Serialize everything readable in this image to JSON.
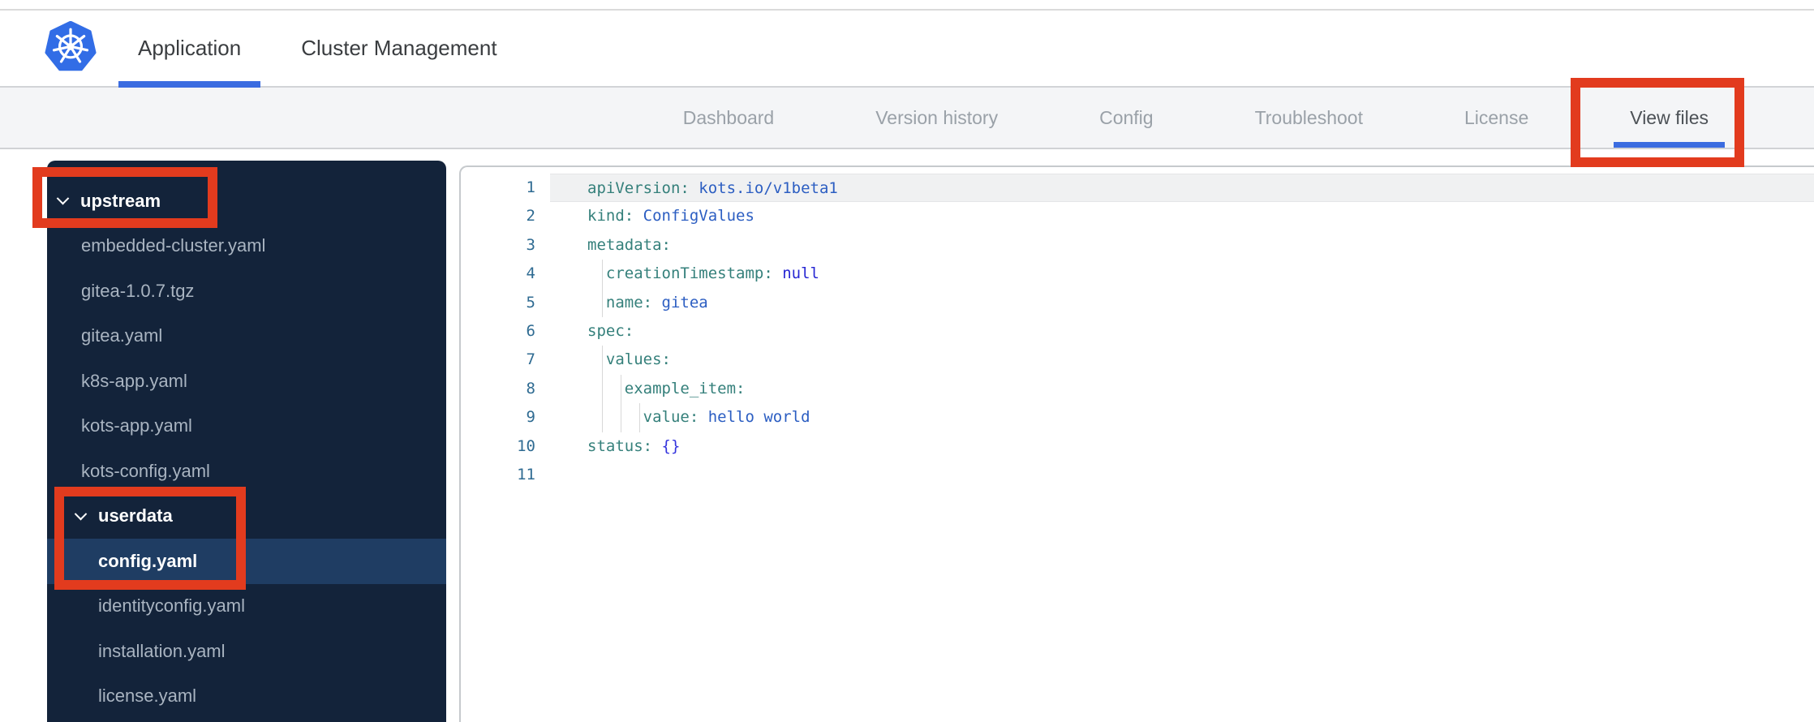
{
  "header": {
    "logo": "kubernetes-helm-wheel",
    "tabs": [
      {
        "label": "Application",
        "active": true
      },
      {
        "label": "Cluster Management",
        "active": false
      }
    ]
  },
  "subnav": {
    "items": [
      {
        "label": "Dashboard",
        "active": false
      },
      {
        "label": "Version history",
        "active": false
      },
      {
        "label": "Config",
        "active": false
      },
      {
        "label": "Troubleshoot",
        "active": false
      },
      {
        "label": "License",
        "active": false
      },
      {
        "label": "View files",
        "active": true,
        "annotated": true
      }
    ]
  },
  "file_tree": {
    "items": [
      {
        "type": "folder",
        "label": "upstream",
        "level": 0,
        "expanded": true,
        "annotated": true
      },
      {
        "type": "file",
        "label": "embedded-cluster.yaml",
        "level": 1
      },
      {
        "type": "file",
        "label": "gitea-1.0.7.tgz",
        "level": 1
      },
      {
        "type": "file",
        "label": "gitea.yaml",
        "level": 1
      },
      {
        "type": "file",
        "label": "k8s-app.yaml",
        "level": 1
      },
      {
        "type": "file",
        "label": "kots-app.yaml",
        "level": 1
      },
      {
        "type": "file",
        "label": "kots-config.yaml",
        "level": 1
      },
      {
        "type": "folder",
        "label": "userdata",
        "level": 1,
        "expanded": true,
        "annotated": true
      },
      {
        "type": "file",
        "label": "config.yaml",
        "level": 2,
        "selected": true,
        "annotated": true
      },
      {
        "type": "file",
        "label": "identityconfig.yaml",
        "level": 2
      },
      {
        "type": "file",
        "label": "installation.yaml",
        "level": 2
      },
      {
        "type": "file",
        "label": "license.yaml",
        "level": 2
      }
    ]
  },
  "editor": {
    "language": "yaml",
    "lines": [
      {
        "num": "1",
        "active": true,
        "guides": 0,
        "tokens": [
          [
            "key",
            "apiVersion:"
          ],
          [
            "val",
            " kots.io/v1beta1"
          ]
        ]
      },
      {
        "num": "2",
        "guides": 0,
        "tokens": [
          [
            "key",
            "kind:"
          ],
          [
            "val",
            " ConfigValues"
          ]
        ]
      },
      {
        "num": "3",
        "guides": 0,
        "tokens": [
          [
            "key",
            "metadata:"
          ]
        ]
      },
      {
        "num": "4",
        "guides": 1,
        "tokens": [
          [
            "key",
            "  creationTimestamp:"
          ],
          [
            "kw",
            " null"
          ]
        ]
      },
      {
        "num": "5",
        "guides": 1,
        "tokens": [
          [
            "key",
            "  name:"
          ],
          [
            "val",
            " gitea"
          ]
        ]
      },
      {
        "num": "6",
        "guides": 0,
        "tokens": [
          [
            "key",
            "spec:"
          ]
        ]
      },
      {
        "num": "7",
        "guides": 1,
        "tokens": [
          [
            "key",
            "  values:"
          ]
        ]
      },
      {
        "num": "8",
        "guides": 2,
        "tokens": [
          [
            "key",
            "    example_item:"
          ]
        ]
      },
      {
        "num": "9",
        "guides": 3,
        "tokens": [
          [
            "key",
            "      value:"
          ],
          [
            "val",
            " hello world"
          ]
        ]
      },
      {
        "num": "10",
        "guides": 0,
        "tokens": [
          [
            "key",
            "status:"
          ],
          [
            "kw2",
            " {}"
          ]
        ]
      },
      {
        "num": "11",
        "guides": 0,
        "tokens": []
      }
    ]
  },
  "annotations": {
    "color": "#E23B1E",
    "highlighted": [
      "View files",
      "upstream",
      "userdata / config.yaml"
    ]
  },
  "colors": {
    "accent_blue": "#3B6CE0",
    "annotation_red": "#E23B1E",
    "sidebar_bg": "#13233A",
    "sidebar_selected_bg": "#1F3D63",
    "sidebar_file_text": "#A9B4C1",
    "yaml_key": "#35807B",
    "yaml_value": "#2C5EC2",
    "yaml_null": "#2727D3",
    "yaml_braces": "#3434DD",
    "line_number": "#2F6B92",
    "kubernetes_blue": "#326DE6"
  }
}
